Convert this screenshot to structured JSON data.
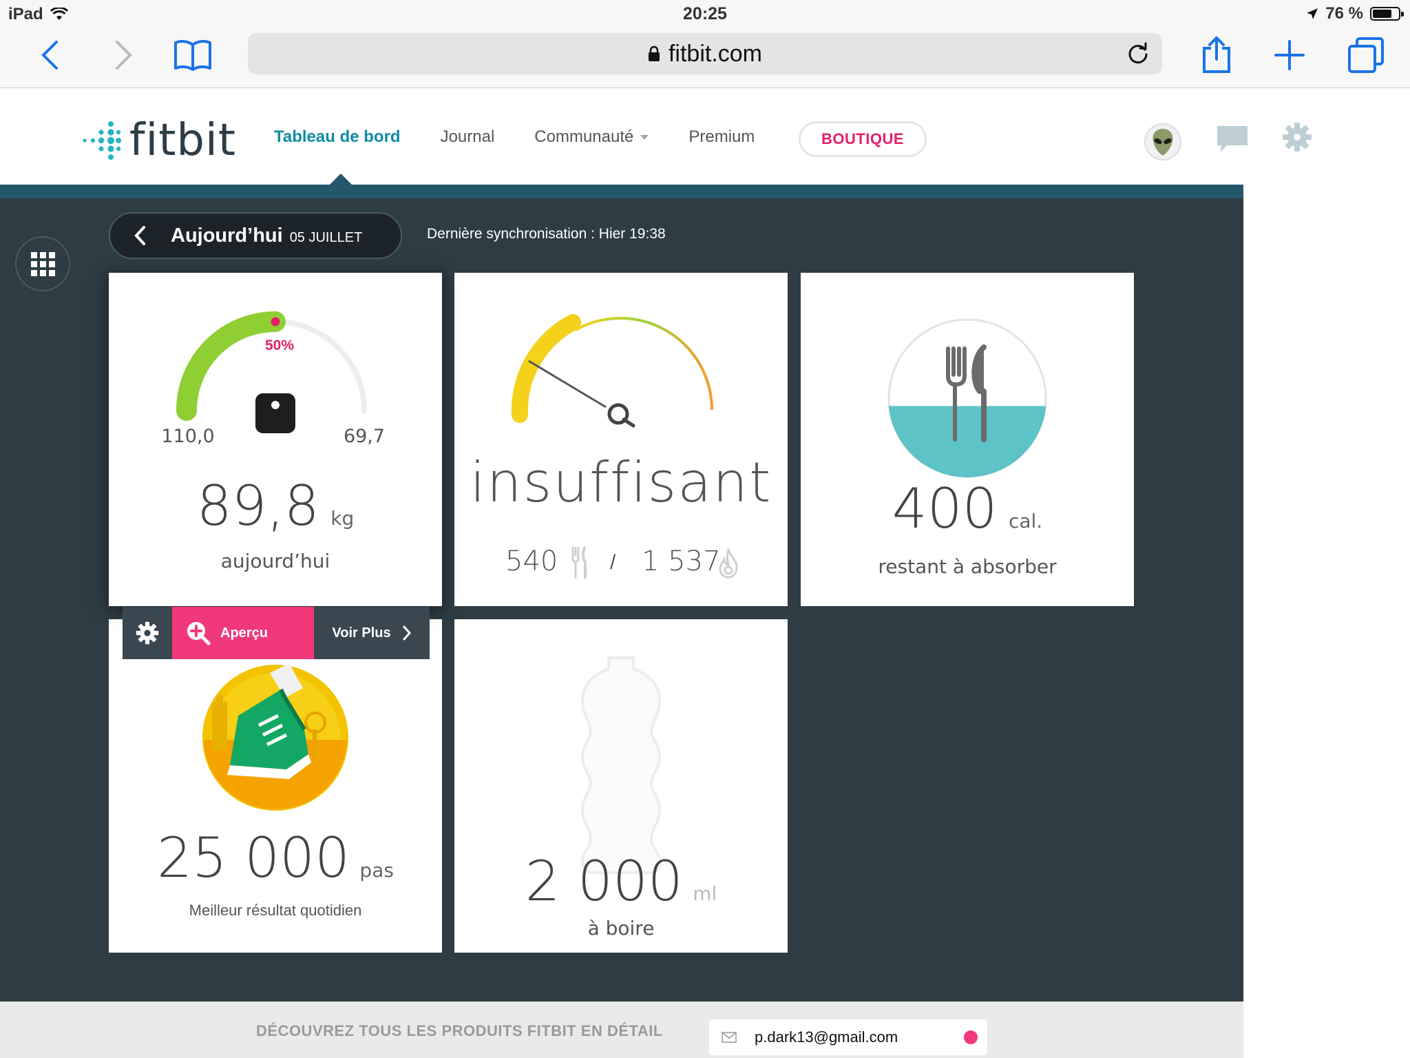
{
  "status_bar": {
    "device": "iPad",
    "time": "20:25",
    "battery_text": "76 %",
    "battery_level": 0.76
  },
  "browser": {
    "url": "fitbit.com"
  },
  "header": {
    "logo_text": "fitbit",
    "nav": {
      "dashboard": "Tableau de bord",
      "journal": "Journal",
      "community": "Communauté",
      "premium": "Premium"
    },
    "shop_label": "BOUTIQUE"
  },
  "dashboard": {
    "day_label": "Aujourd’hui",
    "date_label": "05 JUILLET",
    "sync_text": "Dernière synchronisation : Hier 19:38"
  },
  "tiles": {
    "weight": {
      "progress_label": "50%",
      "progress": 0.5,
      "start": "110,0",
      "goal": "69,7",
      "value": "89,8",
      "unit": "kg",
      "caption": "aujourd’hui"
    },
    "energy": {
      "status": "insuffisant",
      "intake": "540",
      "separator": "/",
      "burned": "1 537"
    },
    "food": {
      "value": "400",
      "unit": "cal.",
      "caption": "restant à absorber",
      "fill_level": 0.45
    },
    "steps": {
      "value": "25 000",
      "unit": "pas",
      "caption": "Meilleur résultat quotidien"
    },
    "water": {
      "value": "2 000",
      "unit": "ml",
      "caption": "à boire"
    }
  },
  "tile_toolbar": {
    "preview_label": "Aperçu",
    "more_label": "Voir Plus"
  },
  "footer": {
    "cta": "DÉCOUVREZ TOUS LES PRODUITS FITBIT EN DÉTAIL",
    "email_value": "p.dark13@gmail.com"
  },
  "colors": {
    "accent_teal": "#0f8ca5",
    "brand_pink": "#e5206a",
    "dashboard_bg": "#2e3c43",
    "water_teal": "#5ec3c6"
  }
}
